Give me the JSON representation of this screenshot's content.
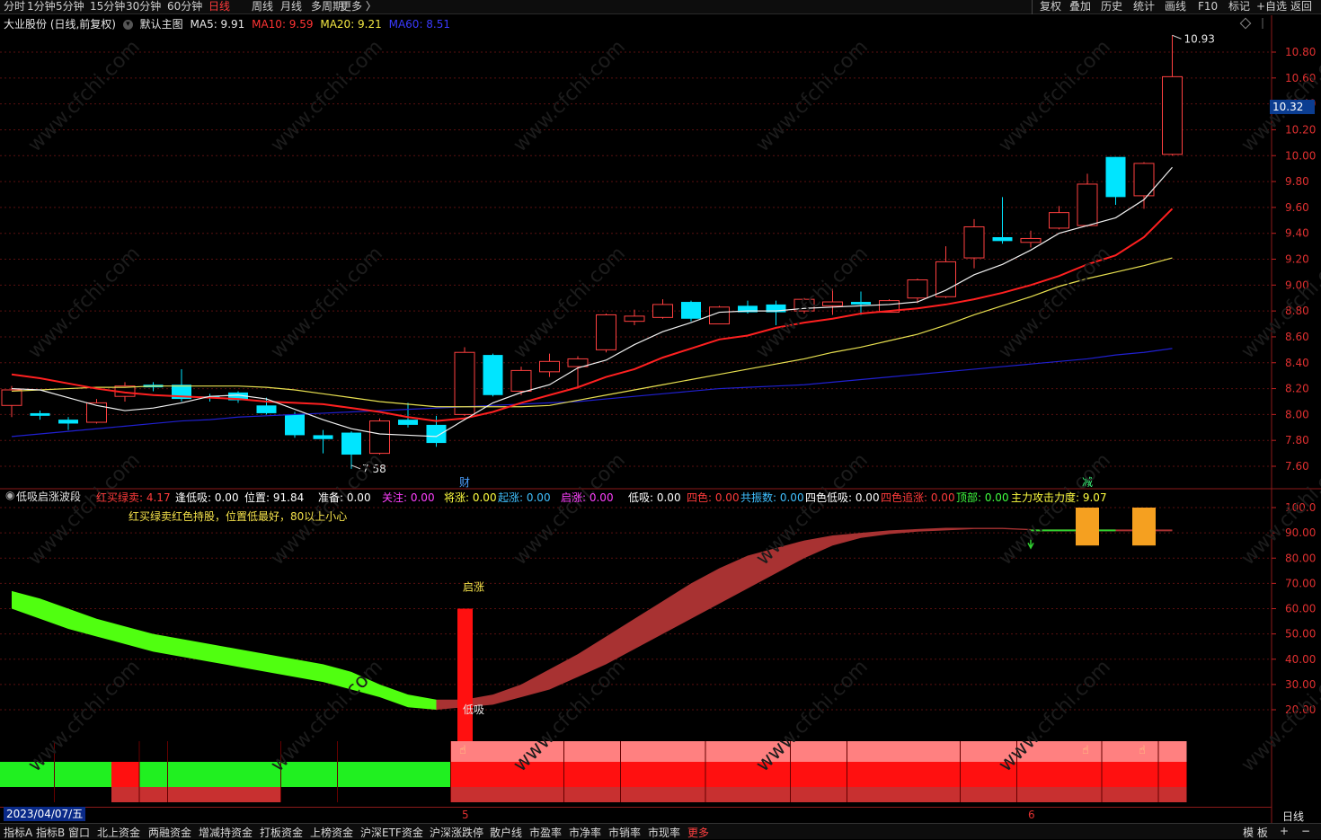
{
  "period_tabs": [
    "分时",
    "1分钟",
    "5分钟",
    "15分钟",
    "30分钟",
    "60分钟",
    "日线",
    "周线",
    "月线",
    "多周期",
    "更多 〉"
  ],
  "active_period": "日线",
  "tools": [
    "复权",
    "叠加",
    "历史",
    "统计",
    "画线",
    "F10",
    "标记",
    "+自选",
    "返回"
  ],
  "title": {
    "stock": "大业股份 (日线,前复权)",
    "template": "默认主图",
    "ma5": "MA5: 9.91",
    "ma10": "MA10: 9.59",
    "ma20": "MA20: 9.21",
    "ma60": "MA60: 8.51"
  },
  "price_axis": [
    "10.80",
    "10.60",
    "10.40",
    "10.20",
    "10.00",
    "9.80",
    "9.60",
    "9.40",
    "9.20",
    "9.00",
    "8.80",
    "8.60",
    "8.40",
    "8.20",
    "8.00",
    "7.80",
    "7.60"
  ],
  "current_price": "10.32",
  "high_label": "10.93",
  "low_label": "7.58",
  "event_marks": [
    "财",
    "减"
  ],
  "indicator": {
    "name": "低吸启涨波段",
    "fields": [
      {
        "label": "红买绿卖: 4.17",
        "color": "#ff3b3b"
      },
      {
        "label": "逢低吸: 0.00",
        "color": "#ffffff"
      },
      {
        "label": "位置: 91.84",
        "color": "#ffffff"
      },
      {
        "label": "准备: 0.00",
        "color": "#ffffff"
      },
      {
        "label": "关注: 0.00",
        "color": "#ff40ff"
      },
      {
        "label": "将涨: 0.00",
        "color": "#ffff40"
      },
      {
        "label": "起涨: 0.00",
        "color": "#40c0ff"
      },
      {
        "label": "启涨: 0.00",
        "color": "#ff40ff"
      },
      {
        "label": "低吸: 0.00",
        "color": "#ffffff"
      },
      {
        "label": "四色: 0.00",
        "color": "#ff3b3b"
      },
      {
        "label": "共振数: 0.00",
        "color": "#40c0ff"
      },
      {
        "label": "四色低吸: 0.00",
        "color": "#ffffff"
      },
      {
        "label": "四色追涨: 0.00",
        "color": "#ff3b3b"
      },
      {
        "label": "顶部: 0.00",
        "color": "#40ff40"
      },
      {
        "label": "主力攻击力度: 9.07",
        "color": "#ffff40"
      }
    ],
    "note": "红买绿卖红色持股，位置低最好，80以上小心",
    "axis": [
      "100.0",
      "90.00",
      "80.00",
      "70.00",
      "60.00",
      "50.00",
      "40.00",
      "30.00",
      "20.00"
    ],
    "signal_qizhang": "启涨",
    "signal_dixi": "低吸"
  },
  "date_label": "2023/04/07/五",
  "month_marks": [
    "5",
    "6"
  ],
  "period_label_right": "日线",
  "bottom_tabs": [
    "指标A",
    "指标B",
    "窗口",
    "北上资金",
    "两融资金",
    "增减持资金",
    "打板资金",
    "上榜资金",
    "沪深ETF资金",
    "沪深涨跌停",
    "散户线",
    "市盈率",
    "市净率",
    "市销率",
    "市现率",
    "更多"
  ],
  "bottom_right": [
    "模 板",
    "+",
    "−"
  ],
  "chart_data": {
    "type": "candlestick",
    "title": "大业股份 (日线,前复权)",
    "ylim": [
      7.5,
      10.95
    ],
    "candles": [
      {
        "o": 8.07,
        "c": 8.19,
        "h": 8.22,
        "l": 7.98
      },
      {
        "o": 8.01,
        "c": 7.99,
        "h": 8.03,
        "l": 7.96
      },
      {
        "o": 7.96,
        "c": 7.93,
        "h": 7.98,
        "l": 7.88
      },
      {
        "o": 7.94,
        "c": 8.09,
        "h": 8.12,
        "l": 7.93
      },
      {
        "o": 8.14,
        "c": 8.22,
        "h": 8.25,
        "l": 8.1
      },
      {
        "o": 8.23,
        "c": 8.21,
        "h": 8.25,
        "l": 8.18
      },
      {
        "o": 8.23,
        "c": 8.12,
        "h": 8.35,
        "l": 8.1
      },
      {
        "o": 8.14,
        "c": 8.13,
        "h": 8.16,
        "l": 8.1
      },
      {
        "o": 8.17,
        "c": 8.11,
        "h": 8.18,
        "l": 8.09
      },
      {
        "o": 8.07,
        "c": 8.01,
        "h": 8.13,
        "l": 8.0
      },
      {
        "o": 8.0,
        "c": 7.84,
        "h": 8.02,
        "l": 7.82
      },
      {
        "o": 7.84,
        "c": 7.81,
        "h": 7.88,
        "l": 7.7
      },
      {
        "o": 7.86,
        "c": 7.69,
        "h": 7.87,
        "l": 7.58
      },
      {
        "o": 7.7,
        "c": 7.95,
        "h": 7.97,
        "l": 7.69
      },
      {
        "o": 7.96,
        "c": 7.92,
        "h": 8.09,
        "l": 7.9
      },
      {
        "o": 7.92,
        "c": 7.78,
        "h": 7.99,
        "l": 7.75
      },
      {
        "o": 8.0,
        "c": 8.48,
        "h": 8.52,
        "l": 7.99
      },
      {
        "o": 8.46,
        "c": 8.15,
        "h": 8.47,
        "l": 8.14
      },
      {
        "o": 8.18,
        "c": 8.34,
        "h": 8.37,
        "l": 8.15
      },
      {
        "o": 8.33,
        "c": 8.41,
        "h": 8.47,
        "l": 8.29
      },
      {
        "o": 8.37,
        "c": 8.43,
        "h": 8.45,
        "l": 8.2
      },
      {
        "o": 8.5,
        "c": 8.77,
        "h": 8.78,
        "l": 8.48
      },
      {
        "o": 8.72,
        "c": 8.76,
        "h": 8.81,
        "l": 8.69
      },
      {
        "o": 8.75,
        "c": 8.85,
        "h": 8.89,
        "l": 8.74
      },
      {
        "o": 8.87,
        "c": 8.74,
        "h": 8.88,
        "l": 8.72
      },
      {
        "o": 8.7,
        "c": 8.83,
        "h": 8.84,
        "l": 8.7
      },
      {
        "o": 8.84,
        "c": 8.79,
        "h": 8.88,
        "l": 8.78
      },
      {
        "o": 8.85,
        "c": 8.79,
        "h": 8.88,
        "l": 8.69
      },
      {
        "o": 8.8,
        "c": 8.89,
        "h": 8.9,
        "l": 8.78
      },
      {
        "o": 8.84,
        "c": 8.87,
        "h": 8.97,
        "l": 8.77
      },
      {
        "o": 8.87,
        "c": 8.85,
        "h": 8.95,
        "l": 8.77
      },
      {
        "o": 8.79,
        "c": 8.88,
        "h": 8.89,
        "l": 8.79
      },
      {
        "o": 8.9,
        "c": 9.04,
        "h": 9.05,
        "l": 8.86
      },
      {
        "o": 8.91,
        "c": 9.18,
        "h": 9.3,
        "l": 8.9
      },
      {
        "o": 9.21,
        "c": 9.45,
        "h": 9.51,
        "l": 9.13
      },
      {
        "o": 9.37,
        "c": 9.34,
        "h": 9.68,
        "l": 9.32
      },
      {
        "o": 9.33,
        "c": 9.36,
        "h": 9.42,
        "l": 9.29
      },
      {
        "o": 9.44,
        "c": 9.56,
        "h": 9.61,
        "l": 9.43
      },
      {
        "o": 9.46,
        "c": 9.78,
        "h": 9.86,
        "l": 9.45
      },
      {
        "o": 9.99,
        "c": 9.68,
        "h": 9.99,
        "l": 9.62
      },
      {
        "o": 9.69,
        "c": 9.94,
        "h": 9.95,
        "l": 9.59
      },
      {
        "o": 10.01,
        "c": 10.61,
        "h": 10.93,
        "l": 10.0
      }
    ],
    "ma5": [
      8.2,
      8.19,
      8.13,
      8.07,
      8.03,
      8.05,
      8.09,
      8.14,
      8.15,
      8.12,
      8.04,
      7.96,
      7.89,
      7.85,
      7.84,
      7.83,
      7.96,
      8.09,
      8.17,
      8.23,
      8.36,
      8.42,
      8.54,
      8.64,
      8.71,
      8.79,
      8.8,
      8.8,
      8.82,
      8.83,
      8.84,
      8.85,
      8.87,
      8.96,
      9.08,
      9.16,
      9.27,
      9.4,
      9.46,
      9.52,
      9.66,
      9.91
    ],
    "ma10": [
      8.31,
      8.28,
      8.24,
      8.2,
      8.17,
      8.15,
      8.14,
      8.13,
      8.12,
      8.1,
      8.09,
      8.08,
      8.05,
      8.02,
      7.98,
      7.95,
      7.97,
      8.02,
      8.09,
      8.15,
      8.21,
      8.29,
      8.35,
      8.44,
      8.51,
      8.58,
      8.61,
      8.67,
      8.71,
      8.74,
      8.78,
      8.8,
      8.82,
      8.85,
      8.89,
      8.94,
      9.0,
      9.07,
      9.16,
      9.23,
      9.37,
      9.59
    ],
    "ma20": [
      8.18,
      8.19,
      8.2,
      8.21,
      8.21,
      8.22,
      8.22,
      8.22,
      8.22,
      8.21,
      8.19,
      8.16,
      8.13,
      8.1,
      8.08,
      8.06,
      8.06,
      8.06,
      8.06,
      8.07,
      8.11,
      8.15,
      8.19,
      8.23,
      8.27,
      8.31,
      8.35,
      8.39,
      8.43,
      8.48,
      8.52,
      8.57,
      8.62,
      8.69,
      8.77,
      8.84,
      8.91,
      8.99,
      9.05,
      9.1,
      9.15,
      9.21
    ],
    "ma60": [
      7.83,
      7.85,
      7.87,
      7.89,
      7.91,
      7.93,
      7.95,
      7.96,
      7.98,
      7.99,
      8.0,
      8.01,
      8.02,
      8.03,
      8.04,
      8.05,
      8.06,
      8.07,
      8.08,
      8.09,
      8.1,
      8.12,
      8.14,
      8.16,
      8.18,
      8.2,
      8.21,
      8.22,
      8.23,
      8.25,
      8.27,
      8.29,
      8.31,
      8.33,
      8.35,
      8.37,
      8.39,
      8.41,
      8.43,
      8.46,
      8.48,
      8.51
    ],
    "indicator_band": {
      "ylim": [
        0,
        105
      ],
      "upper": [
        67,
        64,
        60,
        56,
        53,
        50,
        48,
        46,
        44,
        42,
        40,
        38,
        35,
        30,
        26,
        24,
        24,
        26,
        30,
        36,
        42,
        49,
        56,
        63,
        70,
        76,
        81,
        84,
        87,
        89,
        90,
        91,
        91.5,
        92,
        92,
        92,
        91.5,
        91,
        91,
        91,
        91,
        91
      ],
      "lower": [
        60,
        56,
        52,
        49,
        46,
        43,
        41,
        39,
        37,
        35,
        33,
        31,
        28,
        25,
        21,
        20,
        21,
        22,
        25,
        28,
        33,
        38,
        44,
        50,
        56,
        62,
        68,
        74,
        80,
        85,
        88,
        89.5,
        90.5,
        91,
        91.5,
        91.5,
        91,
        91,
        90.5,
        90.5,
        91,
        91
      ],
      "bullish_from_index": 16,
      "qizhang_bar": {
        "index": 16,
        "from": 20,
        "to": 60
      }
    },
    "state_rows": {
      "row1_red_segments": [
        [
          16,
          41
        ]
      ],
      "row2_green_segments": [
        [
          0,
          15
        ]
      ],
      "row2_red_segments": [
        [
          4,
          4
        ],
        [
          16,
          41
        ]
      ]
    },
    "orange_markers": [
      38,
      40
    ]
  }
}
